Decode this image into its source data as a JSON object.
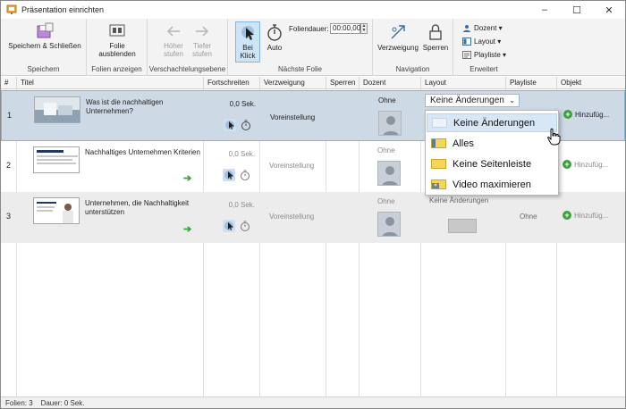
{
  "window": {
    "title": "Präsentation einrichten",
    "minimize": "–",
    "maximize": "☐",
    "close": "✕"
  },
  "ribbon": {
    "groups": {
      "save": {
        "label": "Speichern",
        "button": "Speichern & Schließen"
      },
      "slides": {
        "label": "Folien anzeigen",
        "button_line1": "Folie",
        "button_line2": "ausblenden"
      },
      "nesting": {
        "label": "Verschachtelungsebene",
        "up_line1": "Höher",
        "up_line2": "stufen",
        "down_line1": "Tiefer",
        "down_line2": "stufen"
      },
      "next": {
        "label": "Nächste Folie",
        "click_line1": "Bei",
        "click_line2": "Klick",
        "auto": "Auto",
        "duration_label": "Foliendauer:",
        "duration_value": "00:00,00"
      },
      "navigation": {
        "label": "Navigation",
        "branch": "Verzweigung",
        "lock": "Sperren"
      },
      "advanced": {
        "label": "Erweitert",
        "presenter": "Dozent",
        "layout": "Layout",
        "playlist": "Playliste"
      }
    }
  },
  "table": {
    "headers": [
      "#",
      "Titel",
      "Fortschreiten",
      "Verzweigung",
      "Sperren",
      "Dozent",
      "Layout",
      "Playliste",
      "Objekt"
    ],
    "rows": [
      {
        "num": "1",
        "title": "Was ist die nachhaltigen Unternehmen?",
        "advance": "0,0 Sek.",
        "branch": "Voreinstellung",
        "presenter": "Ohne",
        "layout": "Keine Änderungen",
        "playlist": "",
        "object": "Hinzufüg..."
      },
      {
        "num": "2",
        "title": "Nachhaltiges Unternehmen Kriterien",
        "advance": "0,0 Sek.",
        "branch": "Voreinstellung",
        "presenter": "Ohne",
        "layout": "Keine Änderungen",
        "playlist": "",
        "object": "Hinzufüg..."
      },
      {
        "num": "3",
        "title": "Unternehmen, die Nachhaltigkeit unterstützen",
        "advance": "0,0 Sek.",
        "branch": "Voreinstellung",
        "presenter": "Ohne",
        "layout": "Keine Änderungen",
        "playlist": "Ohne",
        "object": "Hinzufüg..."
      }
    ]
  },
  "layout_dropdown": {
    "selected": "Keine Änderungen",
    "options": [
      "Keine Änderungen",
      "Alles",
      "Keine Seitenleiste",
      "Video maximieren"
    ]
  },
  "status": {
    "slides": "Folien: 3",
    "duration": "Dauer:  0 Sek."
  },
  "colors": {
    "accent": "#cde4f7",
    "selection": "#cdd9e5",
    "green": "#3aa23a"
  }
}
